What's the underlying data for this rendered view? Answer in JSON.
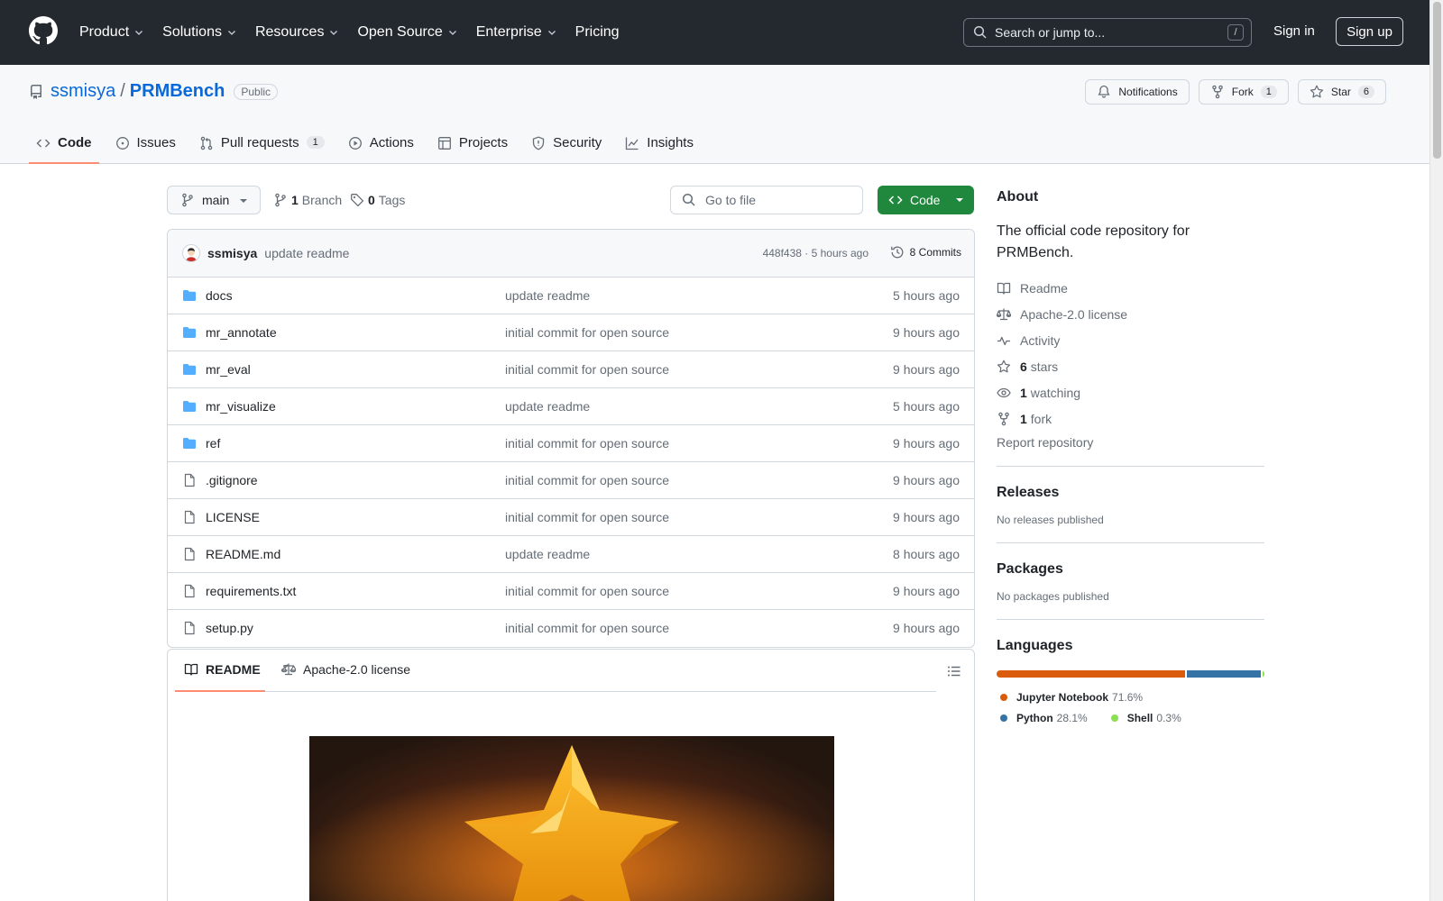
{
  "header": {
    "nav": [
      {
        "label": "Product",
        "dropdown": true
      },
      {
        "label": "Solutions",
        "dropdown": true
      },
      {
        "label": "Resources",
        "dropdown": true
      },
      {
        "label": "Open Source",
        "dropdown": true
      },
      {
        "label": "Enterprise",
        "dropdown": true
      },
      {
        "label": "Pricing",
        "dropdown": false
      }
    ],
    "search_placeholder": "Search or jump to...",
    "search_shortcut": "/",
    "sign_in": "Sign in",
    "sign_up": "Sign up"
  },
  "repo": {
    "owner": "ssmisya",
    "separator": "/",
    "name": "PRMBench",
    "visibility": "Public",
    "notifications_label": "Notifications",
    "fork_label": "Fork",
    "fork_count": "1",
    "star_label": "Star",
    "star_count": "6"
  },
  "tabs": [
    {
      "label": "Code",
      "icon": "code-icon",
      "selected": true
    },
    {
      "label": "Issues",
      "icon": "issue-icon",
      "selected": false
    },
    {
      "label": "Pull requests",
      "icon": "pull-request-icon",
      "count": "1",
      "selected": false
    },
    {
      "label": "Actions",
      "icon": "play-icon",
      "selected": false
    },
    {
      "label": "Projects",
      "icon": "table-icon",
      "selected": false
    },
    {
      "label": "Security",
      "icon": "shield-icon",
      "selected": false
    },
    {
      "label": "Insights",
      "icon": "graph-icon",
      "selected": false
    }
  ],
  "toolbar": {
    "branch": "main",
    "branch_count": "1",
    "branch_label": "Branch",
    "tag_count": "0",
    "tag_label": "Tags",
    "go_to_file": "Go to file",
    "code_button": "Code"
  },
  "commit": {
    "author": "ssmisya",
    "message": "update readme",
    "meta": "448f438 · 5 hours ago",
    "commits_label": "8 Commits"
  },
  "files": [
    {
      "type": "dir",
      "name": "docs",
      "message": "update readme",
      "time": "5 hours ago"
    },
    {
      "type": "dir",
      "name": "mr_annotate",
      "message": "initial commit for open source",
      "time": "9 hours ago"
    },
    {
      "type": "dir",
      "name": "mr_eval",
      "message": "initial commit for open source",
      "time": "9 hours ago"
    },
    {
      "type": "dir",
      "name": "mr_visualize",
      "message": "update readme",
      "time": "5 hours ago"
    },
    {
      "type": "dir",
      "name": "ref",
      "message": "initial commit for open source",
      "time": "9 hours ago"
    },
    {
      "type": "file",
      "name": ".gitignore",
      "message": "initial commit for open source",
      "time": "9 hours ago"
    },
    {
      "type": "file",
      "name": "LICENSE",
      "message": "initial commit for open source",
      "time": "9 hours ago"
    },
    {
      "type": "file",
      "name": "README.md",
      "message": "update readme",
      "time": "8 hours ago"
    },
    {
      "type": "file",
      "name": "requirements.txt",
      "message": "initial commit for open source",
      "time": "9 hours ago"
    },
    {
      "type": "file",
      "name": "setup.py",
      "message": "initial commit for open source",
      "time": "9 hours ago"
    }
  ],
  "readme": {
    "tab_readme": "README",
    "tab_license": "Apache-2.0 license"
  },
  "about": {
    "heading": "About",
    "description": "The official code repository for PRMBench.",
    "links": [
      {
        "icon": "book-icon",
        "strong": "",
        "text": "Readme"
      },
      {
        "icon": "law-icon",
        "strong": "",
        "text": "Apache-2.0 license"
      },
      {
        "icon": "pulse-icon",
        "strong": "",
        "text": "Activity"
      },
      {
        "icon": "star-icon",
        "strong": "6",
        "text": "stars"
      },
      {
        "icon": "eye-icon",
        "strong": "1",
        "text": "watching"
      },
      {
        "icon": "fork-icon",
        "strong": "1",
        "text": "fork"
      }
    ],
    "report": "Report repository"
  },
  "releases": {
    "heading": "Releases",
    "sub": "No releases published"
  },
  "packages": {
    "heading": "Packages",
    "sub": "No packages published"
  },
  "languages": {
    "heading": "Languages",
    "items": [
      {
        "name": "Jupyter Notebook",
        "percent": "71.6%",
        "value": 71.6,
        "color": "#DA5B0B"
      },
      {
        "name": "Python",
        "percent": "28.1%",
        "value": 28.1,
        "color": "#3572A5"
      },
      {
        "name": "Shell",
        "percent": "0.3%",
        "value": 0.3,
        "color": "#89e051"
      }
    ]
  }
}
